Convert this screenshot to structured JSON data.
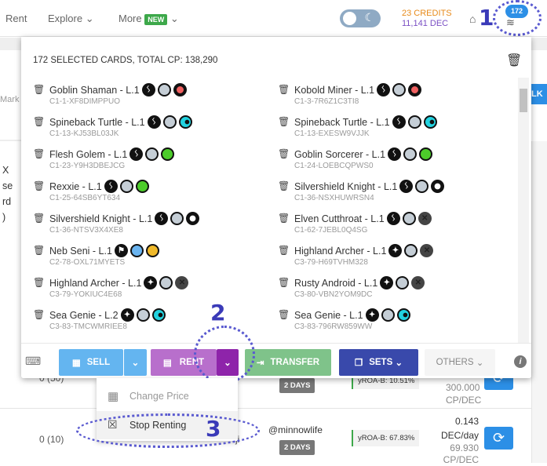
{
  "header": {
    "nav": [
      {
        "label": "Rent"
      },
      {
        "label": "Explore"
      },
      {
        "label": "More"
      }
    ],
    "new_badge": "NEW",
    "credits": "23 CREDITS",
    "dec": "11,141 DEC",
    "selected_count": "172"
  },
  "annotations": [
    "1",
    "2",
    "3"
  ],
  "background": {
    "left_fragments": [
      "Mark",
      "X",
      "se",
      "rd",
      ")"
    ],
    "right_button": "LK",
    "rows": [
      {
        "qty": "0 (50)",
        "days": "2 DAYS",
        "yroa": "yROA-B: 10.51%",
        "price": "300.000",
        "unit": "CP/DEC"
      },
      {
        "qty": "0 (10)",
        "renter_fragment": "ji",
        "renter": "@minnowlife",
        "days": "2 DAYS",
        "yroa": "yROA-B: 67.83%",
        "price": "0.143",
        "price_unit": "DEC/day",
        "cp": "69.930",
        "unit": "CP/DEC"
      }
    ]
  },
  "panel": {
    "title": "172 SELECTED CARDS, TOTAL CP: 138,290",
    "cards": [
      {
        "name": "Goblin Shaman - L.1",
        "id": "C1-1-XF8DIMPPUO",
        "icons": [
          "neutral-icon",
          "gray-icon",
          "fire-icon"
        ]
      },
      {
        "name": "Kobold Miner - L.1",
        "id": "C1-3-7R6Z1C3TI8",
        "icons": [
          "neutral-icon",
          "gray-icon",
          "fire-icon"
        ]
      },
      {
        "name": "Spineback Turtle - L.1",
        "id": "C1-13-KJ53BL03JK",
        "icons": [
          "neutral-icon",
          "gray-icon",
          "water-icon"
        ]
      },
      {
        "name": "Spineback Turtle - L.1",
        "id": "C1-13-EXESW9VJJK",
        "icons": [
          "neutral-icon",
          "gray-icon",
          "water-icon"
        ]
      },
      {
        "name": "Flesh Golem - L.1",
        "id": "C1-23-Y9H3DBEJCG",
        "icons": [
          "neutral-icon",
          "gray-icon",
          "earth-icon"
        ]
      },
      {
        "name": "Goblin Sorcerer - L.1",
        "id": "C1-24-LOEBCQPWS0",
        "icons": [
          "neutral-icon",
          "gray-icon",
          "earth-icon"
        ]
      },
      {
        "name": "Rexxie - L.1",
        "id": "C1-25-64SB6YT634",
        "icons": [
          "neutral-icon",
          "gray-icon",
          "earth-icon"
        ]
      },
      {
        "name": "Silvershield Knight - L.1",
        "id": "C1-36-NSXHUWRSN4",
        "icons": [
          "neutral-icon",
          "gray-icon",
          "life-icon"
        ]
      },
      {
        "name": "Silvershield Knight - L.1",
        "id": "C1-36-NTSV3X4XE8",
        "icons": [
          "neutral-icon",
          "gray-icon",
          "life-icon"
        ]
      },
      {
        "name": "Elven Cutthroat - L.1",
        "id": "C1-62-7JEBL0Q4SG",
        "icons": [
          "neutral-icon",
          "gray-icon",
          "death-icon"
        ]
      },
      {
        "name": "Neb Seni - L.1",
        "id": "C2-78-OXL71MYETS",
        "icons": [
          "rare-icon",
          "blue-icon",
          "dragon-icon"
        ]
      },
      {
        "name": "Highland Archer - L.1",
        "id": "C3-79-H69TVHM328",
        "icons": [
          "epic-icon",
          "gray-icon",
          "death-icon"
        ]
      },
      {
        "name": "Highland Archer - L.1",
        "id": "C3-79-YOKIUC4E68",
        "icons": [
          "epic-icon",
          "gray-icon",
          "death-icon"
        ]
      },
      {
        "name": "Rusty Android - L.1",
        "id": "C3-80-VBN2YOM9DC",
        "icons": [
          "epic-icon",
          "gray-icon",
          "death-icon"
        ]
      },
      {
        "name": "Sea Genie - L.2",
        "id": "C3-83-TMCWMRIEE8",
        "icons": [
          "epic-icon",
          "gray-icon",
          "water-icon"
        ]
      },
      {
        "name": "Sea Genie - L.1",
        "id": "C3-83-796RW859WW",
        "icons": [
          "epic-icon",
          "gray-icon",
          "water-icon"
        ]
      }
    ],
    "toolbar": {
      "sell": "SELL",
      "rent": "RENT",
      "transfer": "TRANSFER",
      "sets": "SETS",
      "others": "OTHERS"
    }
  },
  "rent_menu": [
    {
      "label": "Change Price"
    },
    {
      "label": "Stop Renting"
    }
  ],
  "colors": {
    "sell": "#64b5f0",
    "rent": "#b86fcc",
    "rent_dd": "#8e24aa",
    "transfer": "#7fc38a",
    "sets": "#3949ab",
    "accent": "#2c8fe6"
  }
}
